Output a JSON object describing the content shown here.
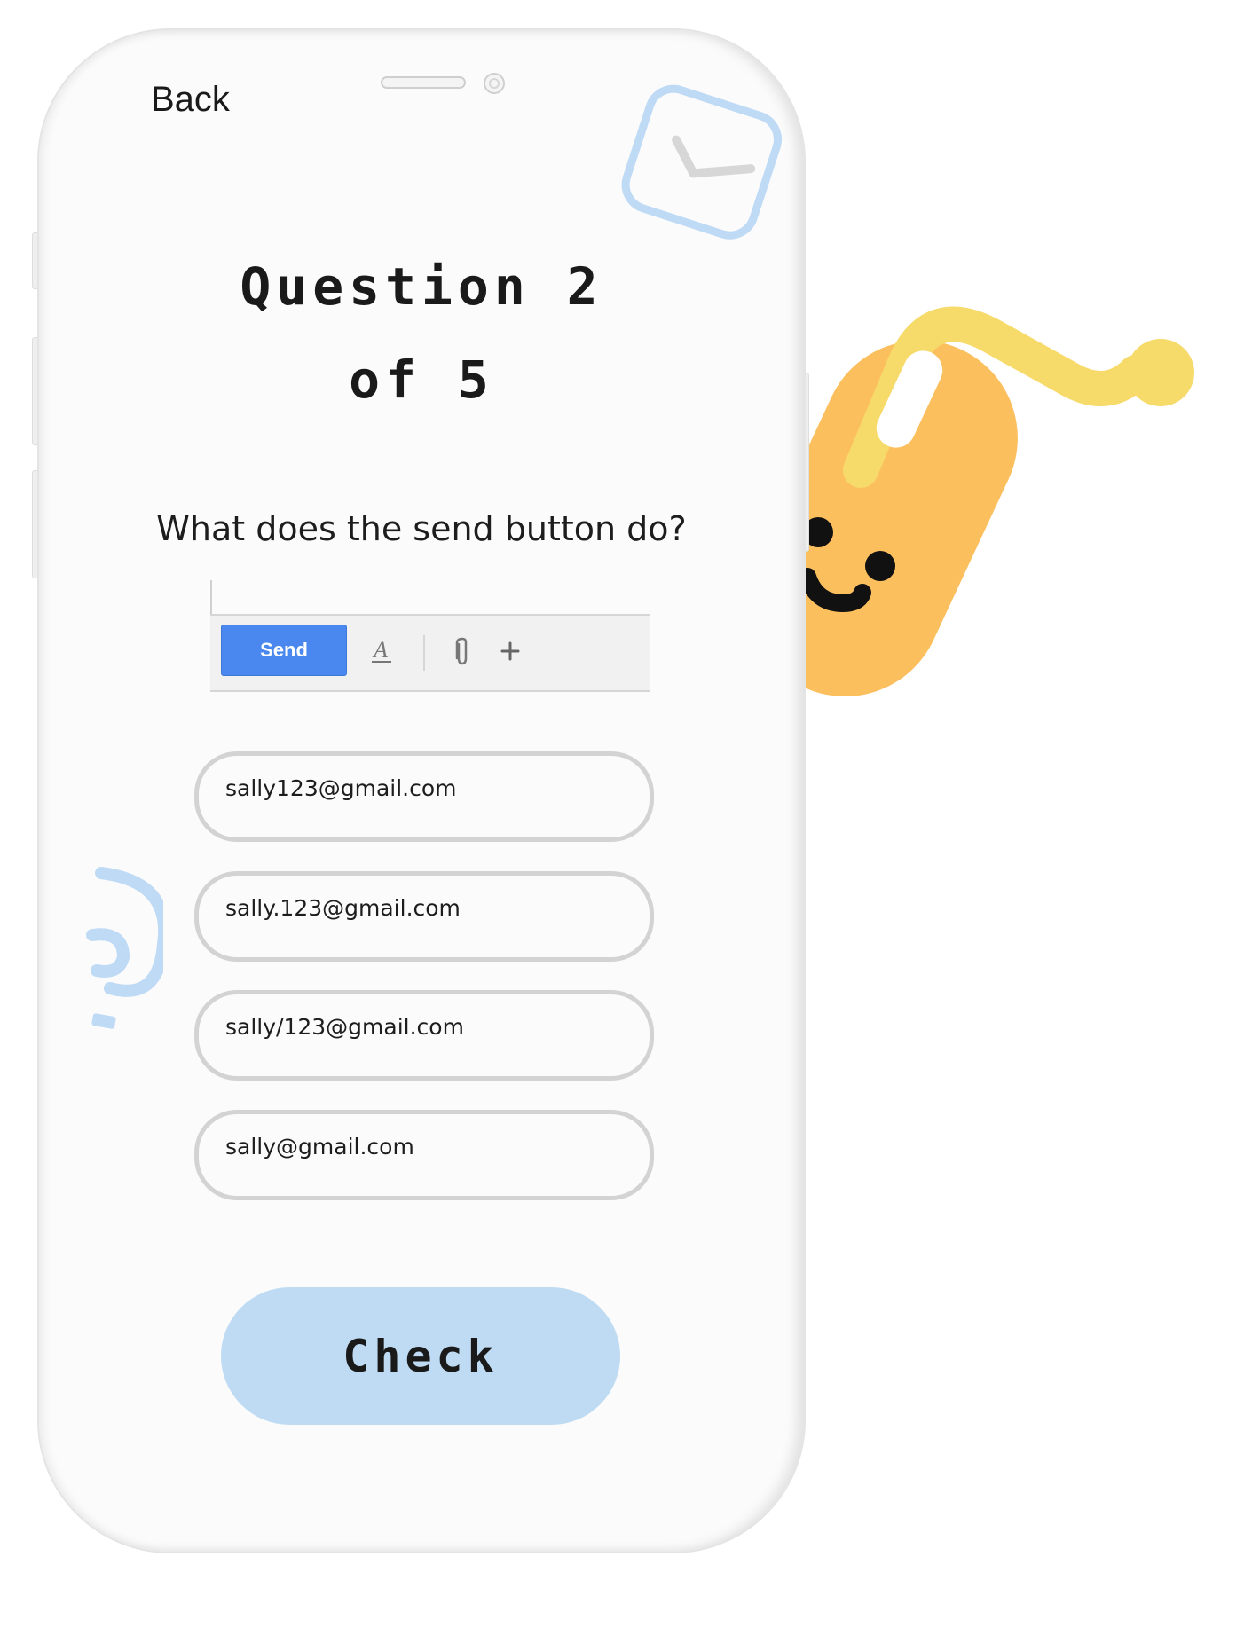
{
  "nav": {
    "back_label": "Back"
  },
  "quiz": {
    "title_line1": "Question 2",
    "title_line2": "of 5",
    "question_text": "What does the send button do?"
  },
  "toolbar": {
    "send_label": "Send",
    "icons": [
      "text-format-icon",
      "attachment-icon",
      "plus-icon"
    ]
  },
  "options": [
    "sally123@gmail.com",
    "sally.123@gmail.com",
    "sally/123@gmail.com",
    "sally@gmail.com"
  ],
  "actions": {
    "check_label": "Check"
  },
  "colors": {
    "accent_blue": "#bedbf3",
    "send_blue": "#4a87ee",
    "mascot_orange": "#fbbf5e",
    "mascot_yellow": "#f6da6a",
    "deco_blue": "#bfdaf5"
  }
}
